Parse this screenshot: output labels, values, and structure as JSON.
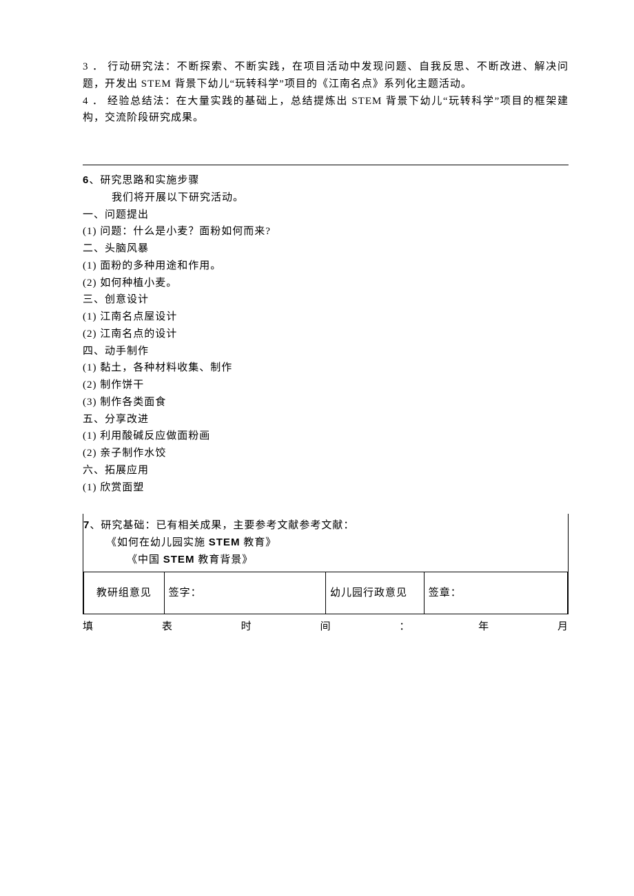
{
  "top": {
    "item3_num": "3",
    "item3_dot": "．",
    "item3_text": "行动研究法：不断探索、不断实践，在项目活动中发现问题、自我反思、不断改进、解决问题，开发出 STEM 背景下幼儿“玩转科学”项目的《江南名点》系列化主题活动。",
    "item4_num": "4",
    "item4_dot": "．",
    "item4_text": "经验总结法：在大量实践的基础上，总结提炼出 STEM 背景下幼儿“玩转科学”项目的框架建构，交流阶段研究成果。"
  },
  "s6": {
    "num": "6",
    "sep": "、",
    "title": "研究思路和实施步骤",
    "intro": "我们将开展以下研究活动。",
    "h1": "一、问题提出",
    "h1_1": "(1) 问题：什么是小麦？面粉如何而来?",
    "h2": "二、头脑风暴",
    "h2_1": "(1) 面粉的多种用途和作用。",
    "h2_2": "(2) 如何种植小麦。",
    "h3": "三、创意设计",
    "h3_1": "(1) 江南名点屋设计",
    "h3_2": "(2) 江南名点的设计",
    "h4": "四、动手制作",
    "h4_1": "(1) 黏土，各种材料收集、制作",
    "h4_2": "(2) 制作饼干",
    "h4_3": "(3) 制作各类面食",
    "h5": "五、分享改进",
    "h5_1": "(1) 利用酸碱反应做面粉画",
    "h5_2": "(2) 亲子制作水饺",
    "h6": "六、拓展应用",
    "h6_1": "(1) 欣赏面塑"
  },
  "s7": {
    "num": "7",
    "sep": "、",
    "title": "研究基础：已有相关成果，主要参考文献参考文献：",
    "ref1_l": "《如何在幼儿园实施 ",
    "ref1_b": "STEM",
    "ref1_r": " 教育》",
    "ref2_l": "《中国 ",
    "ref2_b": "STEM",
    "ref2_r": " 教育背景》"
  },
  "sig": {
    "c1": "教研组意见",
    "c2": "签字：",
    "c3": "幼儿园行政意见",
    "c4": "签章："
  },
  "foot": {
    "a": "填",
    "b": "表",
    "c": "时",
    "d": "间",
    "e": "：",
    "f": "年",
    "g": "月"
  }
}
